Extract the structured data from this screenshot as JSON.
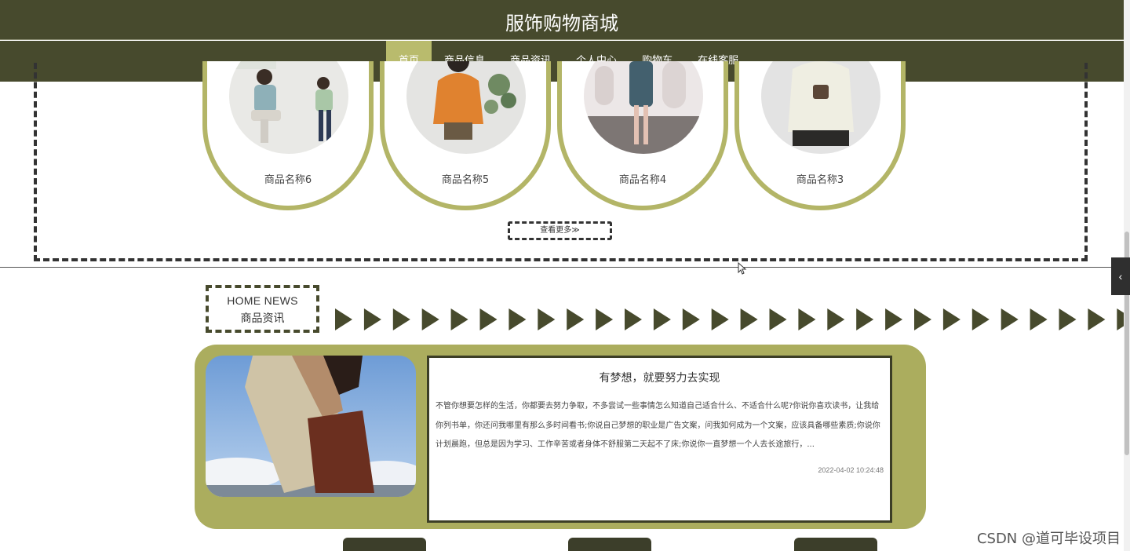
{
  "header": {
    "title": "服饰购物商城"
  },
  "nav": {
    "items": [
      {
        "label": "首页",
        "active": true
      },
      {
        "label": "商品信息"
      },
      {
        "label": "商品资讯"
      },
      {
        "label": "个人中心"
      },
      {
        "label": "购物车"
      },
      {
        "label": "在线客服"
      }
    ]
  },
  "products": {
    "items": [
      {
        "name": "商品名称6"
      },
      {
        "name": "商品名称5"
      },
      {
        "name": "商品名称4"
      },
      {
        "name": "商品名称3"
      }
    ],
    "more_label": "查看更多≫"
  },
  "news": {
    "section_en": "HOME NEWS",
    "section_cn": "商品资讯",
    "headline": "有梦想，就要努力去实现",
    "body": "不管你想要怎样的生活，你都要去努力争取，不多尝试一些事情怎么知道自己适合什么、不适合什么呢?你说你喜欢读书，让我给你列书单，你还问我哪里有那么多时间看书;你说自己梦想的职业是广告文案，问我如何成为一个文案，应该具备哪些素质;你说你计划晨跑，但总是因为学习、工作辛苦或者身体不舒服第二天起不了床;你说你一直梦想一个人去长途旅行，...",
    "date": "2022-04-02 10:24:48"
  },
  "watermark": "CSDN @道可毕设项目",
  "sidebar": {
    "toggle_icon": "‹"
  },
  "colors": {
    "header_bg": "#474a2d",
    "accent": "#b9bb6d",
    "panel": "#abad5e"
  }
}
